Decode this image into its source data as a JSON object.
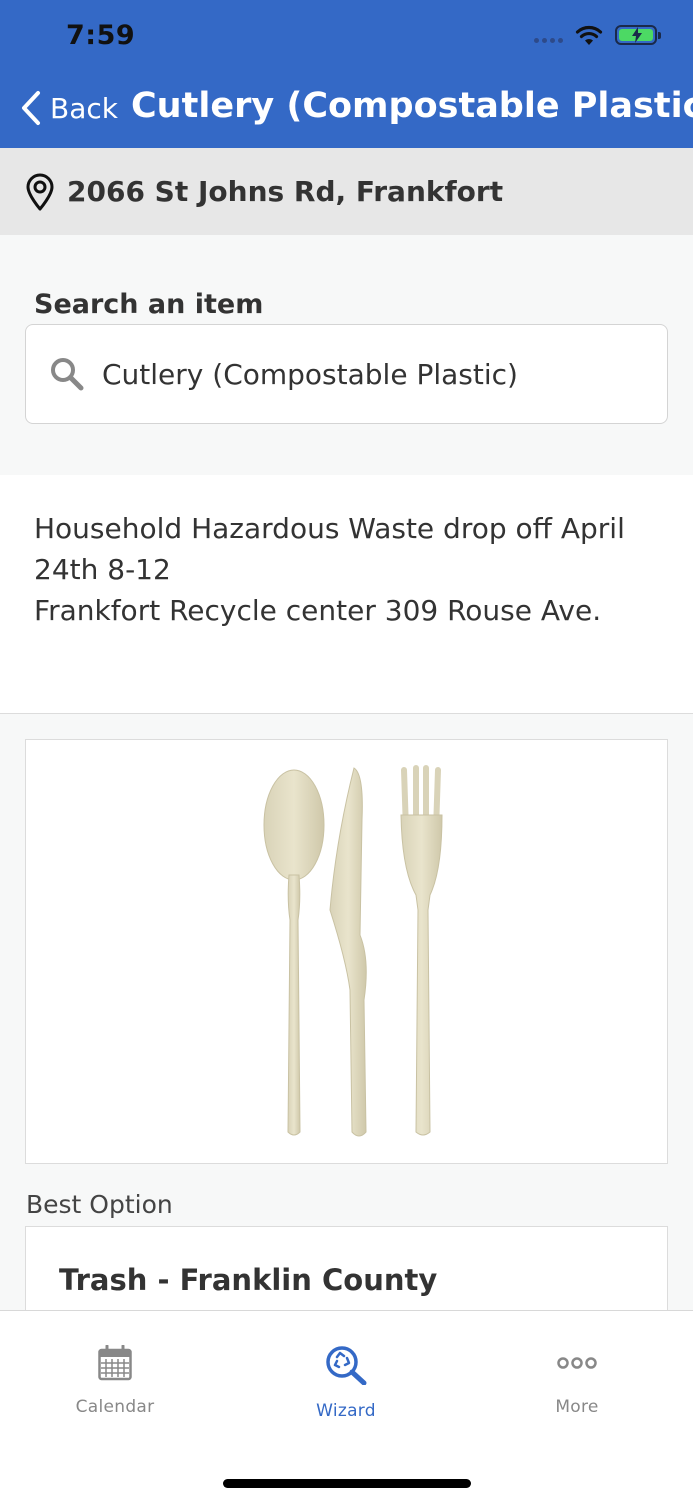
{
  "status_bar": {
    "time": "7:59"
  },
  "header": {
    "back_label": "Back",
    "title": "Cutlery (Compostable Plastic)",
    "color": "#3469C6"
  },
  "location": {
    "address": "2066 St Johns Rd, Frankfort"
  },
  "search": {
    "label": "Search an item",
    "value": "Cutlery (Compostable Plastic)"
  },
  "notice": {
    "lines": [
      "Household Hazardous Waste drop off April 24th 8-12",
      "Frankfort Recycle center 309 Rouse Ave."
    ]
  },
  "item_image": {
    "icon": "compostable-cutlery-image"
  },
  "result": {
    "section_label": "Best Option",
    "option_title": "Trash - Franklin County"
  },
  "tabbar": {
    "items": [
      {
        "label": "Calendar",
        "icon": "calendar-icon",
        "active": false
      },
      {
        "label": "Wizard",
        "icon": "recycle-search-icon",
        "active": true
      },
      {
        "label": "More",
        "icon": "more-dots-icon",
        "active": false
      }
    ],
    "active_color": "#3469C6"
  }
}
